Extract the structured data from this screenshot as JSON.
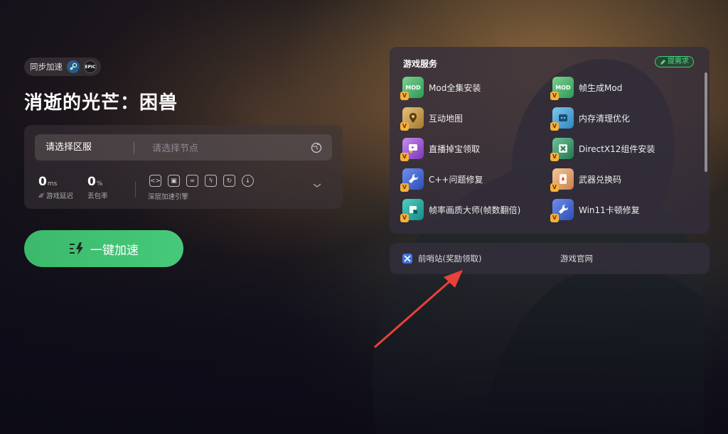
{
  "sync": {
    "label": "同步加速",
    "steam_icon": "steam-icon",
    "epic_text": "EPIC"
  },
  "game": {
    "title": "消逝的光芒：困兽"
  },
  "region": {
    "label": "请选择区服",
    "node_placeholder": "请选择节点"
  },
  "stats": {
    "latency": {
      "value": "0",
      "unit": "ms",
      "label": "游戏延迟"
    },
    "loss": {
      "value": "0",
      "unit": "%",
      "label": "丢包率"
    }
  },
  "engine": {
    "label": "深层加速引擎",
    "icons": [
      "link-icon",
      "image-icon",
      "chain-icon",
      "bolt-icon",
      "refresh-icon",
      "download-icon"
    ]
  },
  "boost": {
    "label": "一键加速"
  },
  "services": {
    "title": "游戏服务",
    "request_label": "提需求",
    "items": [
      {
        "label": "Mod全集安装",
        "icon": "mod-icon",
        "color": "#35b56a"
      },
      {
        "label": "帧生成Mod",
        "icon": "mod-icon",
        "color": "#35b56a"
      },
      {
        "label": "互动地图",
        "icon": "map-icon",
        "color": "#caa04a"
      },
      {
        "label": "内存清理优化",
        "icon": "chip-icon",
        "color": "#3fa8d8"
      },
      {
        "label": "直播掉宝领取",
        "icon": "gift-icon",
        "color": "#a054d6"
      },
      {
        "label": "DirectX12组件安装",
        "icon": "dx-icon",
        "color": "#2f9d64"
      },
      {
        "label": "C++问题修复",
        "icon": "wrench-icon",
        "color": "#3b63d1"
      },
      {
        "label": "武器兑换码",
        "icon": "ticket-icon",
        "color": "#e0a36a"
      },
      {
        "label": "帧率画质大师(帧数翻倍)",
        "icon": "frame-icon",
        "color": "#27a79a"
      },
      {
        "label": "Win11卡顿修复",
        "icon": "wrench-icon",
        "color": "#3b63d1"
      }
    ]
  },
  "links": {
    "outpost": "前哨站(奖励领取)",
    "official": "游戏官网"
  }
}
